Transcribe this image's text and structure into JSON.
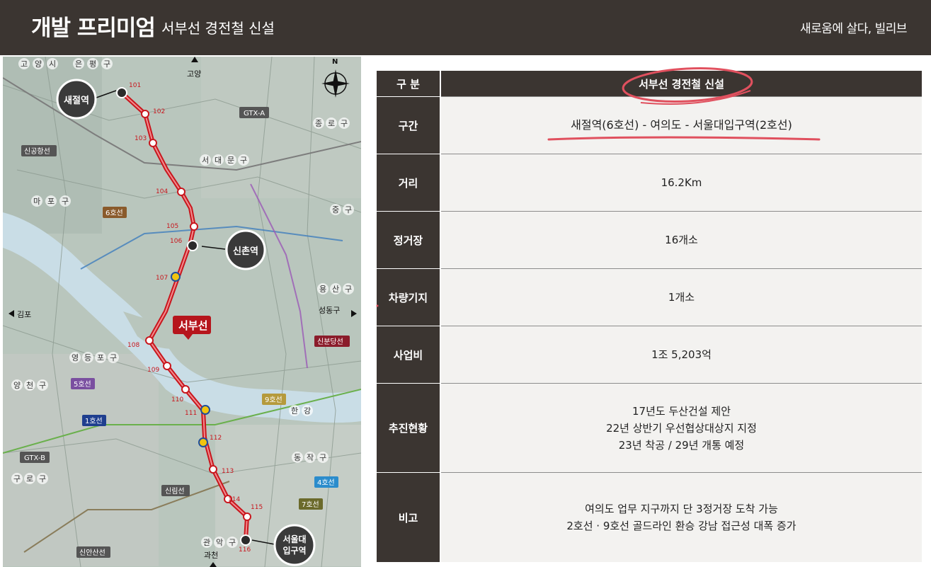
{
  "header": {
    "title": "개발 프리미엄",
    "subtitle": "서부선 경전철 신설",
    "slogan": "새로움에 살다, 빌리브"
  },
  "map": {
    "callouts": {
      "saejeol": "새절역",
      "sinchon": "신촌역",
      "seouldae_1": "서울대",
      "seouldae_2": "입구역",
      "line_name": "서부선"
    },
    "stations": [
      "101",
      "102",
      "103",
      "104",
      "105",
      "106",
      "107",
      "108",
      "109",
      "110",
      "111",
      "112",
      "113",
      "114",
      "115",
      "116"
    ],
    "lines": {
      "gtx_a": "GTX-A",
      "gtx_b": "GTX-B",
      "line1": "1호선",
      "line4": "4호선",
      "line5": "5호선",
      "line6": "6호선",
      "line7": "7호선",
      "line9": "9호선",
      "sinbundang": "신분당선",
      "sinansan": "신안산선",
      "singonghang": "신공항선",
      "sillim": "신림선"
    },
    "directions": {
      "goyang": "고양",
      "gimpo": "김포",
      "seongdong": "성동구",
      "gwacheon": "과천",
      "north": "N"
    },
    "districts": {
      "goyang_si": [
        "고",
        "양",
        "시"
      ],
      "eunpyeong": [
        "은",
        "평",
        "구"
      ],
      "seodaemun": [
        "서",
        "대",
        "문",
        "구"
      ],
      "mapo": [
        "마",
        "포",
        "구"
      ],
      "yeongdeungpo": [
        "영",
        "등",
        "포",
        "구"
      ],
      "yangcheon": [
        "양",
        "천",
        "구"
      ],
      "guro": [
        "구",
        "로",
        "구"
      ],
      "gwanak": [
        "관",
        "악",
        "구"
      ],
      "dongjak": [
        "동",
        "작",
        "구"
      ],
      "yongsan": [
        "용",
        "산",
        "구"
      ],
      "jongno": [
        "종",
        "로",
        "구"
      ],
      "jung": [
        "중",
        "구"
      ],
      "hangang": [
        "한",
        "강"
      ]
    },
    "colors": {
      "route": "#c8161d",
      "callout": "#3a3a3a",
      "line_badge": "#5a5a5a"
    }
  },
  "table": {
    "header": {
      "label": "구 분",
      "value": "서부선 경전철 신설"
    },
    "rows": [
      {
        "label": "구간",
        "lines": [
          "새절역(6호선)  -  여의도  -  서울대입구역(2호선)"
        ]
      },
      {
        "label": "거리",
        "lines": [
          "16.2Km"
        ]
      },
      {
        "label": "정거장",
        "lines": [
          "16개소"
        ]
      },
      {
        "label": "차량기지",
        "lines": [
          "1개소"
        ]
      },
      {
        "label": "사업비",
        "lines": [
          "1조 5,203억"
        ]
      },
      {
        "label": "추진현황",
        "lines": [
          "17년도 두산건설 제안",
          "22년 상반기 우선협상대상지 지정",
          "23년 착공 / 29년 개통 예정"
        ]
      },
      {
        "label": "비고",
        "lines": [
          "여의도 업무 지구까지 단 3정거장 도착 가능",
          "2호선  · 9호선 골드라인 환승 강남 접근성 대폭 증가"
        ]
      }
    ],
    "colors": {
      "label_bg": "#3b3531",
      "value_bg": "#f3f2f0",
      "highlight": "#e0505e"
    }
  }
}
